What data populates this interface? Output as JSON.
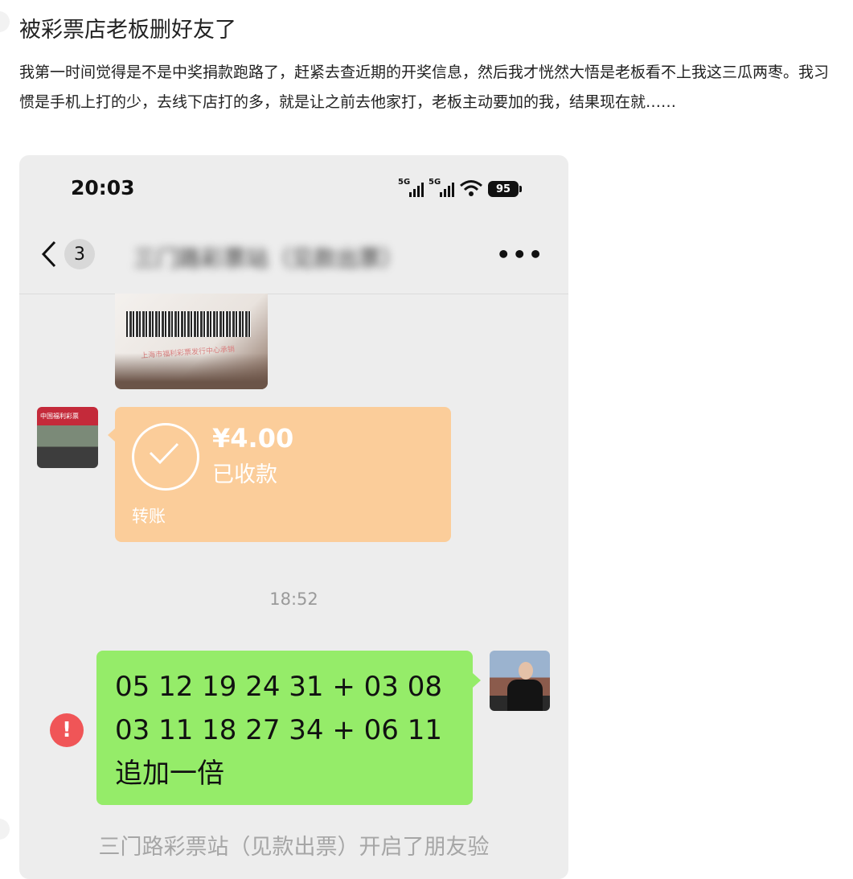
{
  "post": {
    "title": "被彩票店老板删好友了",
    "body": "我第一时间觉得是不是中奖捐款跑路了，赶紧去查近期的开奖信息，然后我才恍然大悟是老板看不上我这三瓜两枣。我习惯是手机上打的少，去线下店打的多，就是让之前去他家打，老板主动要加的我，结果现在就……"
  },
  "phone": {
    "status_bar": {
      "time": "20:03",
      "network_1": "5G",
      "network_2": "5G",
      "battery": "95"
    },
    "nav": {
      "unread_count": "3",
      "chat_title": "三门路彩票站（见款出票）"
    },
    "image_message": {
      "ticket_text": "上海市福利彩票发行中心承销"
    },
    "shop_avatar_sign": "中国福利彩票",
    "transfer": {
      "amount": "¥4.00",
      "status": "已收款",
      "label": "转账"
    },
    "timestamp": "18:52",
    "my_message": {
      "text": "05 12 19 24 31 + 03 08\n03 11 18 27 34 + 06 11   追加一倍",
      "fail_symbol": "!"
    },
    "system_note": "三门路彩票站（见款出票）开启了朋友验"
  },
  "colors": {
    "chat_bg": "#ededed",
    "transfer_bg": "#fbcd9a",
    "my_bubble": "#95ec69",
    "fail_red": "#f05557"
  }
}
